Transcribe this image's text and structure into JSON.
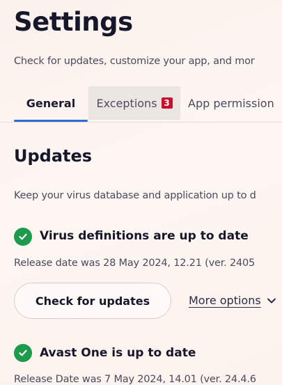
{
  "header": {
    "title": "Settings",
    "subtitle": "Check for updates, customize your app, and mor"
  },
  "tabs": [
    {
      "label": "General",
      "active": true
    },
    {
      "label": "Exceptions",
      "badge": "3"
    },
    {
      "label": "App permission"
    }
  ],
  "updates": {
    "title": "Updates",
    "description": "Keep your virus database and application up to d",
    "virus": {
      "title": "Virus definitions are up to date",
      "detail": "Release date was 28 May 2024, 12.21 (ver. 2405"
    },
    "check_button": "Check for updates",
    "more_options": "More options",
    "app": {
      "title": "Avast One is up to date",
      "detail": "Release Date was 7 May 2024, 14.01 (ver. 24.4.6"
    }
  },
  "colors": {
    "accent": "#2f6bcf",
    "success": "#1e9a4d",
    "badge": "#c8102e"
  }
}
